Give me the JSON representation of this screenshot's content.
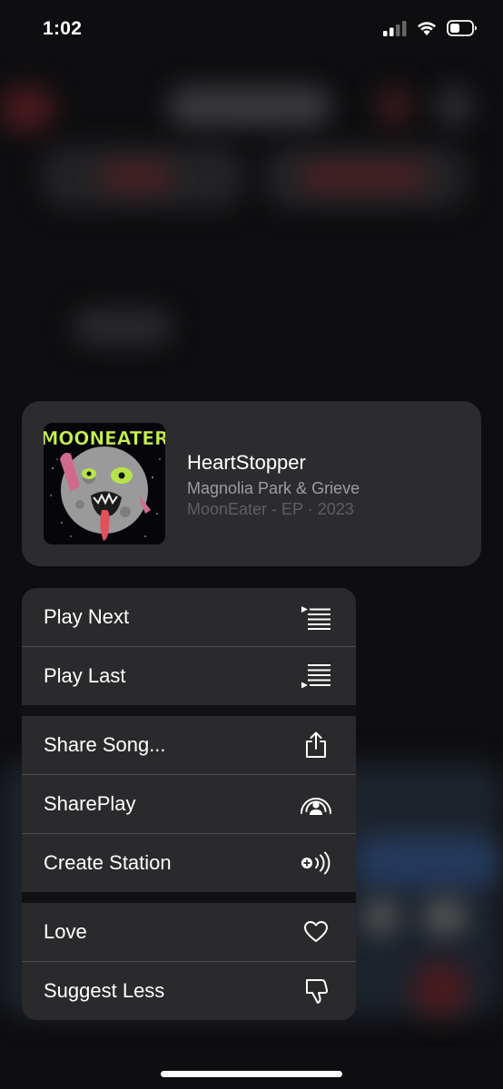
{
  "status": {
    "time": "1:02"
  },
  "song": {
    "title": "HeartStopper",
    "artist": "Magnolia Park & Grieve",
    "album_line": "MoonEater - EP · 2023",
    "artwork_text": "MOONEATER"
  },
  "menu": {
    "play_next": "Play Next",
    "play_last": "Play Last",
    "share_song": "Share Song...",
    "shareplay": "SharePlay",
    "create_station": "Create Station",
    "love": "Love",
    "suggest_less": "Suggest Less"
  },
  "icons": {
    "play_next": "play-next-icon",
    "play_last": "play-last-icon",
    "share": "share-icon",
    "shareplay": "shareplay-icon",
    "station": "station-icon",
    "love": "heart-icon",
    "suggest_less": "thumbs-down-icon"
  },
  "colors": {
    "card": "#2c2c2e",
    "menu_item": "#2a2a2d",
    "secondary_text": "#9d9da2",
    "tertiary_text": "#5f5f64",
    "artwork_lime": "#c6f24e"
  }
}
